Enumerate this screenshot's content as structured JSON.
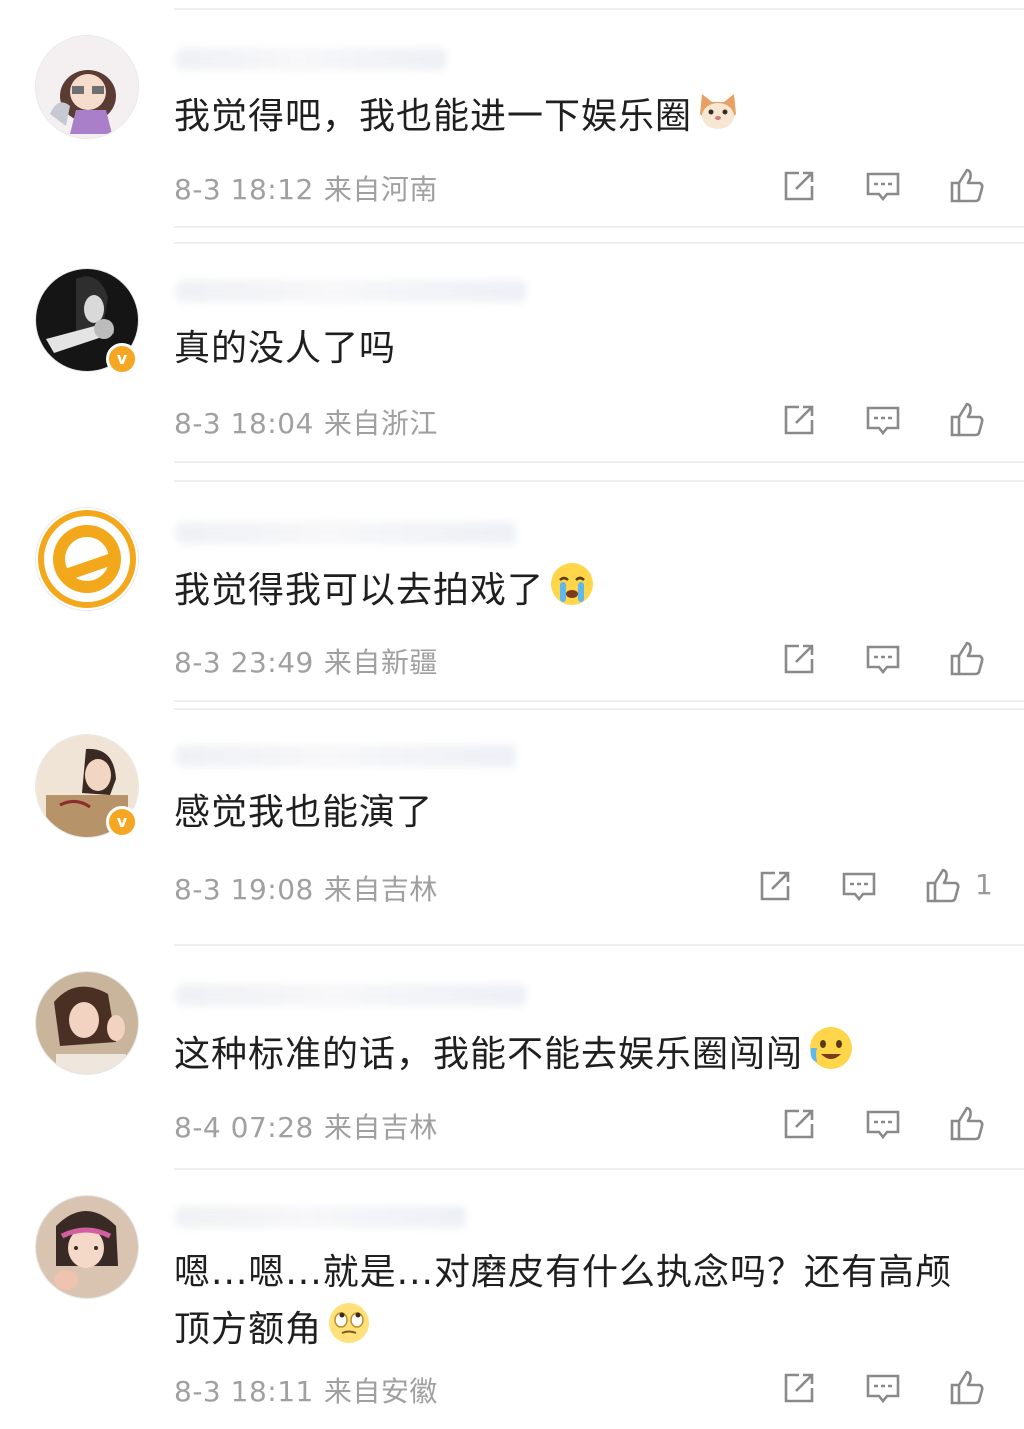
{
  "comments": [
    {
      "text": "我觉得吧，我也能进一下娱乐圈",
      "date": "8-3 18:12",
      "location": "来自河南",
      "emoji": "cat-face-emoji",
      "verified": false,
      "likes": ""
    },
    {
      "text": "真的没人了吗",
      "date": "8-3 18:04",
      "location": "来自浙江",
      "emoji": "",
      "verified": true,
      "likes": ""
    },
    {
      "text": "我觉得我可以去拍戏了",
      "date": "8-3 23:49",
      "location": "来自新疆",
      "emoji": "crying-face-emoji",
      "verified": false,
      "likes": ""
    },
    {
      "text": "感觉我也能演了",
      "date": "8-3 19:08",
      "location": "来自吉林",
      "emoji": "",
      "verified": true,
      "likes": "1"
    },
    {
      "text": "这种标准的话，我能不能去娱乐圈闯闯",
      "date": "8-4 07:28",
      "location": "来自吉林",
      "emoji": "tearful-smile-emoji",
      "verified": false,
      "likes": ""
    },
    {
      "text": "嗯...嗯...就是...对磨皮有什么执念吗？还有高颅顶方额角",
      "date": "8-3 18:11",
      "location": "来自安徽",
      "emoji": "eye-roll-emoji",
      "verified": false,
      "likes": ""
    }
  ],
  "icons": {
    "share": "share-icon",
    "reply": "comment-icon",
    "like": "thumbs-up-icon",
    "verified": "verified-badge-icon"
  },
  "colors": {
    "text": "#1f1f1f",
    "meta": "#a0a0a0",
    "icon": "#8a8a8a",
    "verified": "#f5a623",
    "divider": "#efefef"
  },
  "badge": {
    "verified_glyph": "v"
  }
}
